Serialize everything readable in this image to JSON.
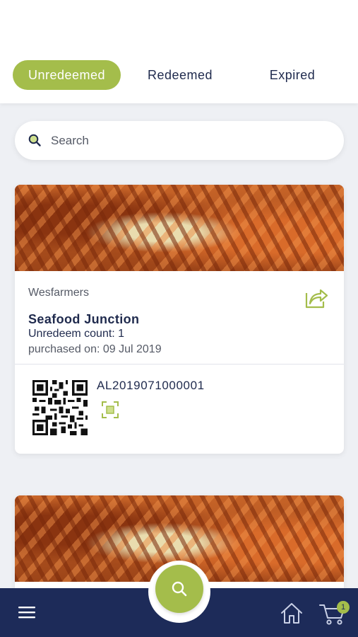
{
  "tabs": [
    {
      "label": "Unredeemed",
      "active": true
    },
    {
      "label": "Redeemed",
      "active": false
    },
    {
      "label": "Expired",
      "active": false
    }
  ],
  "search": {
    "placeholder": "Search",
    "value": ""
  },
  "vouchers": [
    {
      "merchant": "Wesfarmers",
      "title": "Seafood Junction",
      "unredeem_count": "Unredeem count: 1",
      "purchased_on": "purchased on: 09 Jul 2019",
      "code": "AL2019071000001",
      "icons": [
        "share-icon",
        "qr-code",
        "scan-icon"
      ]
    },
    {
      "image": "seafood-photo"
    }
  ],
  "bottom_nav": {
    "icons": [
      "menu-icon",
      "search-icon",
      "home-icon",
      "cart-icon"
    ],
    "cart_badge": "1"
  },
  "colors": {
    "accent": "#a4bd4b",
    "navy": "#1d2b59",
    "text": "#1f2a4d",
    "background": "#eef0f4"
  }
}
